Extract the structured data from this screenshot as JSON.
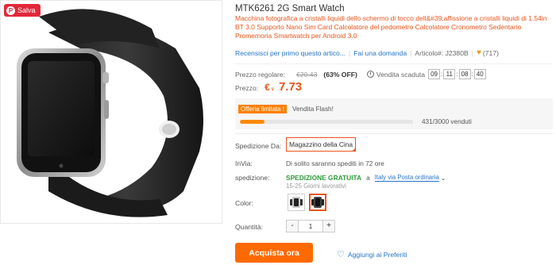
{
  "badge": {
    "label": "Salva",
    "icon": "pinterest-icon"
  },
  "product": {
    "title": "MTK6261 2G Smart Watch",
    "description": "Macchina fotografica a cristalli liquidi dello schermo di tocco dell&#39;affissione a cristalli liquidi di 1.54in BT 3.0 Supporto Nano Sim Card Calcolatore del pedometro Calcolatore Cronometro Sedentario Promemoria Smartwatch per Android 3.0"
  },
  "meta": {
    "review_link": "Recensisci per primo questo artico...",
    "question_link": "Fai una domanda",
    "item_code": "Articolo#: J2380B",
    "wish_count": "(717)"
  },
  "pricing": {
    "regular_label": "Prezzo regolare:",
    "regular_price": "€20.43",
    "discount": "(63% OFF)",
    "sale_ends_label": "Vendita scaduta",
    "timer": [
      "09",
      "11",
      "08",
      "40"
    ],
    "price_label": "Prezzo:",
    "currency": "€",
    "price": "7.73"
  },
  "flash": {
    "tag": "Offerta limitata !",
    "label": "Vendita Flash!",
    "sold_text": "431/3000 venduti",
    "progress": 0.1437
  },
  "shipping": {
    "from_label": "Spedizione Da:",
    "from_value": "Magazzino della Cina",
    "invia_label": "InVia:",
    "invia_value": "Di solito saranno spediti in 72 ore",
    "ship_label": "spedizione:",
    "free_label": "SPEDIZIONE GRATUITA",
    "via": "a",
    "carrier": "Italy via Posta ordinaria",
    "days": "15-25 Giorni lavorativi"
  },
  "options": {
    "color_label": "Color:",
    "colors": [
      "silver-black",
      "black"
    ],
    "selected_color": 1
  },
  "quantity": {
    "label": "Quantità:",
    "minus": "-",
    "value": "1",
    "plus": "+"
  },
  "actions": {
    "buy": "Acquista ora",
    "wishlist": "Aggiungi ai Preferiti"
  },
  "colors": {
    "accent": "#ff6a00",
    "price": "#e8551c",
    "link": "#2673c9",
    "free": "#2e9d3a"
  }
}
